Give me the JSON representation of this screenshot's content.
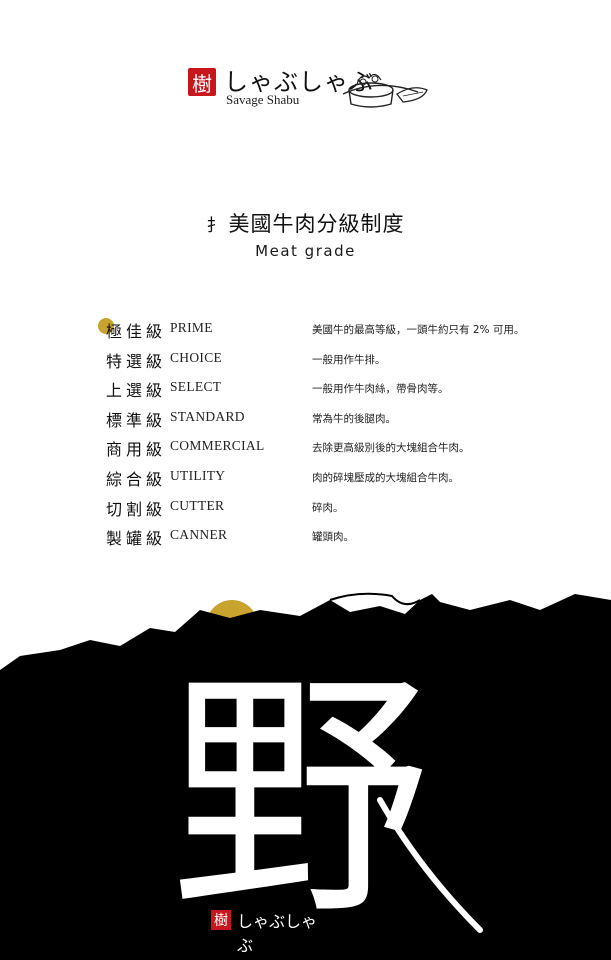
{
  "logo": {
    "seal_char": "樹",
    "name_jp": "しゃぶしゃぶ",
    "name_en": "Savage Shabu"
  },
  "title": {
    "zh": "美國牛肉分級制度",
    "en": "Meat grade"
  },
  "grades": [
    {
      "zh": "極佳級",
      "en": "PRIME",
      "desc": "美國牛的最高等級，一頭牛約只有 2% 可用。"
    },
    {
      "zh": "特選級",
      "en": "CHOICE",
      "desc": "一般用作牛排。"
    },
    {
      "zh": "上選級",
      "en": "SELECT",
      "desc": "一般用作牛肉絲，帶骨肉等。"
    },
    {
      "zh": "標準級",
      "en": "STANDARD",
      "desc": "常為牛的後腿肉。"
    },
    {
      "zh": "商用級",
      "en": "COMMERCIAL",
      "desc": "去除更高級別後的大塊組合牛肉。"
    },
    {
      "zh": "綜合級",
      "en": "UTILITY",
      "desc": "肉的碎塊壓成的大塊組合牛肉。"
    },
    {
      "zh": "切割級",
      "en": "CUTTER",
      "desc": "碎肉。"
    },
    {
      "zh": "製罐級",
      "en": "CANNER",
      "desc": "罐頭肉。"
    }
  ],
  "calligraphy": "野",
  "footer": {
    "seal_char": "樹",
    "name_jp": "しゃぶしゃぶ"
  },
  "colors": {
    "seal_red": "#c8161d",
    "gold": "#c8a32e",
    "ink": "#000000"
  }
}
